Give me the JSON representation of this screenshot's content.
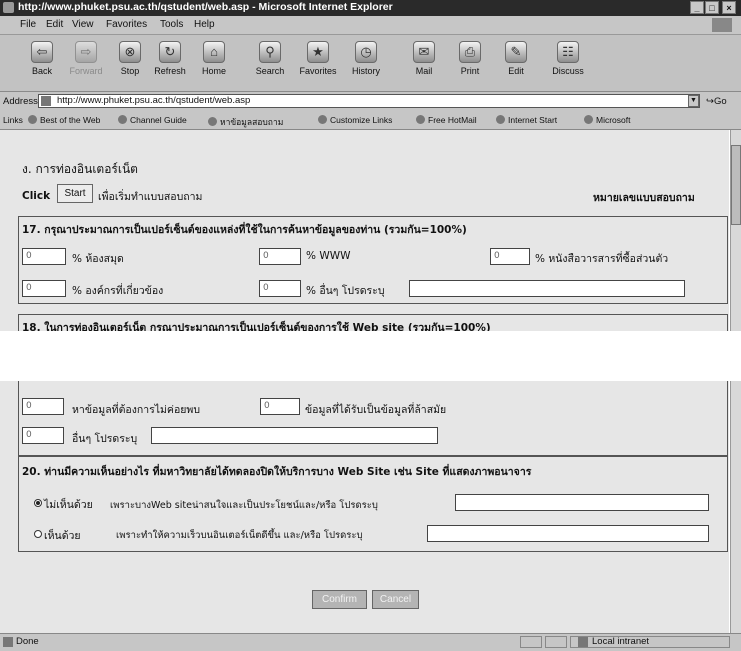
{
  "window": {
    "title": "http://www.phuket.psu.ac.th/qstudent/web.asp - Microsoft Internet Explorer",
    "controls": [
      "_",
      "□",
      "×"
    ]
  },
  "menu": [
    "File",
    "Edit",
    "View",
    "Favorites",
    "Tools",
    "Help"
  ],
  "toolbar": [
    {
      "label": "Back",
      "icon": "back-arrow-icon",
      "glyph": "⇦"
    },
    {
      "label": "Forward",
      "icon": "forward-arrow-icon",
      "glyph": "⇨"
    },
    {
      "label": "Stop",
      "icon": "stop-icon",
      "glyph": "⊗"
    },
    {
      "label": "Refresh",
      "icon": "refresh-icon",
      "glyph": "↻"
    },
    {
      "label": "Home",
      "icon": "home-icon",
      "glyph": "⌂"
    },
    {
      "label": "Search",
      "icon": "search-icon",
      "glyph": "⚲"
    },
    {
      "label": "Favorites",
      "icon": "favorites-icon",
      "glyph": "★"
    },
    {
      "label": "History",
      "icon": "history-icon",
      "glyph": "◷"
    },
    {
      "label": "Mail",
      "icon": "mail-icon",
      "glyph": "✉"
    },
    {
      "label": "Print",
      "icon": "print-icon",
      "glyph": "⎙"
    },
    {
      "label": "Edit",
      "icon": "edit-icon",
      "glyph": "✎"
    },
    {
      "label": "Discuss",
      "icon": "discuss-icon",
      "glyph": "☷"
    }
  ],
  "address": {
    "label": "Address",
    "url": "http://www.phuket.psu.ac.th/qstudent/web.asp",
    "go": "Go"
  },
  "links": {
    "label": "Links",
    "items": [
      "Best of the Web",
      "Channel Guide",
      "หาข้อมูลสอบถาม",
      "Customize Links",
      "Free HotMail",
      "Internet Start",
      "Microsoft"
    ]
  },
  "page": {
    "section_title": "ง. การท่องอินเตอร์เน็ต",
    "click_label": "Click",
    "start_button": "Start",
    "start_hint": "เพื่อเริ่มทำแบบสอบถาม",
    "form_number_label": "หมายเลขแบบสอบถาม",
    "q17": {
      "text": "17. กรุณาประมาณการเป็นเปอร์เซ็นต์ของแหล่งที่ใช้ในการค้นหาข้อมูลของท่าน (รวมกัน=100%)",
      "fields": [
        {
          "value": "0",
          "label": "% ห้องสมุด"
        },
        {
          "value": "0",
          "label": "% WWW"
        },
        {
          "value": "0",
          "label": "% หนังสือวารสารที่ซื้อส่วนตัว"
        },
        {
          "value": "0",
          "label": "% องค์กรที่เกี่ยวข้อง"
        },
        {
          "value": "0",
          "label": "% อื่นๆ โปรดระบุ"
        }
      ],
      "other_specify_value": ""
    },
    "q18": {
      "text": "18. ในการท่องอินเตอร์เน็ต กรุณาประมาณการเป็นเปอร์เซ็นต์ของการใช้ Web site (รวมกัน=100%)"
    },
    "q19": {
      "fields": [
        {
          "value": "0",
          "label": "หาข้อมูลที่ต้องการไม่ค่อยพบ"
        },
        {
          "value": "0",
          "label": "ข้อมูลที่ได้รับเป็นข้อมูลที่ล้าสมัย"
        },
        {
          "value": "0",
          "label": "อื่นๆ โปรดระบุ"
        }
      ],
      "other_specify_value": ""
    },
    "q20": {
      "text": "20. ท่านมีความเห็นอย่างไร ที่มหาวิทยาลัยได้ทดลองปิดให้บริการบาง Web Site เช่น Site ที่แสดงภาพอนาจาร",
      "options": [
        {
          "label": "ไม่เห็นด้วย",
          "reason": "เพราะบางWeb siteน่าสนใจและเป็นประโยชน์และ/หรือ โปรดระบุ",
          "value": ""
        },
        {
          "label": "เห็นด้วย",
          "reason": "เพราะทำให้ความเร็วบนอินเตอร์เน็ตดีขึ้น และ/หรือ โปรดระบุ",
          "value": ""
        }
      ]
    },
    "confirm_button": "Confirm",
    "cancel_button": "Cancel"
  },
  "status": {
    "text": "Done",
    "zone": "Local intranet"
  }
}
